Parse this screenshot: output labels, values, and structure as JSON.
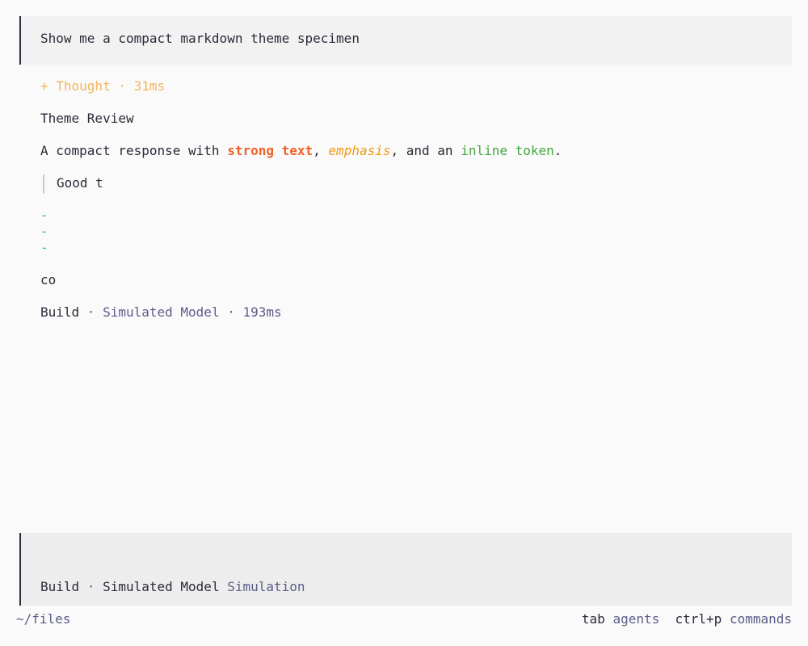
{
  "prompt": {
    "text": "Show me a compact markdown theme specimen"
  },
  "response": {
    "thought": "+ Thought · 31ms",
    "heading": "Theme Review",
    "paragraph": {
      "prefix": "A compact response with ",
      "strong": "strong text",
      "sep1": ", ",
      "emphasis": "emphasis",
      "sep2": ", and an ",
      "inline_code": "inline token",
      "suffix": "."
    },
    "quote": "Good t",
    "bullets": [
      "-",
      "-",
      "-"
    ],
    "code": "co",
    "meta": {
      "agent": "Build",
      "sep1": " · ",
      "model": "Simulated Model",
      "sep2": " · ",
      "duration": "193ms"
    }
  },
  "input": {
    "agent": "Build",
    "sep": " · ",
    "model": "Simulated Model",
    "provider": "Simulation"
  },
  "footer": {
    "path": "~/files",
    "tab_key": "tab",
    "tab_label": "agents",
    "cmd_key": "ctrl+p",
    "cmd_label": "commands"
  },
  "colors": {
    "background": "#fafafa",
    "accent_thought": "#f2b65c",
    "strong": "#f0602a",
    "emphasis": "#f19a12",
    "inline_code": "#44a840",
    "bullet": "#27b6c8",
    "muted": "#5c5c8a",
    "border": "#2d2d40"
  }
}
